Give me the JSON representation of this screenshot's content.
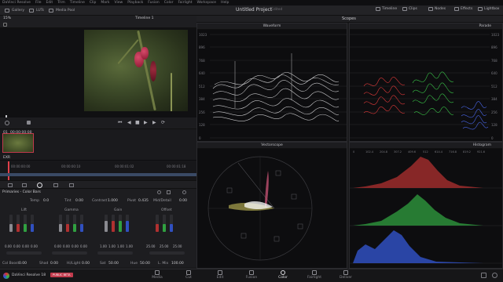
{
  "menubar": {
    "items": [
      "DaVinci Resolve",
      "File",
      "Edit",
      "Trim",
      "Timeline",
      "Clip",
      "Mark",
      "View",
      "Playback",
      "Fusion",
      "Color",
      "Fairlight",
      "Workspace",
      "Help"
    ]
  },
  "topbar": {
    "left_buttons": [
      "Gallery",
      "LUTs",
      "Media Pool"
    ],
    "project_title": "Untitled Project",
    "status": "Edited",
    "right_buttons": [
      "Timeline",
      "Clips",
      "Nodes",
      "Effects",
      "Lightbox"
    ]
  },
  "viewer": {
    "zoom": "15%",
    "timeline_name": "Timeline 1"
  },
  "clip": {
    "index": "01",
    "timecode": "00:00:00:00",
    "codec": "EXR"
  },
  "timeline": {
    "ruler": [
      "00:00:00:00",
      "00:00:00:10",
      "00:00:01:02",
      "00:00:01:18"
    ]
  },
  "scopes": {
    "header": "Scopes",
    "waveform": {
      "title": "Waveform",
      "scale": [
        "1023",
        "896",
        "768",
        "640",
        "512",
        "384",
        "256",
        "128",
        "0"
      ]
    },
    "parade": {
      "title": "Parade",
      "scale": [
        "1023",
        "896",
        "768",
        "640",
        "512",
        "384",
        "256",
        "128",
        "0"
      ]
    },
    "vectorscope": {
      "title": "Vectorscope"
    },
    "histogram": {
      "title": "Histogram",
      "scale": [
        "0",
        "102.4",
        "204.8",
        "307.2",
        "409.6",
        "512",
        "614.4",
        "716.8",
        "819.2",
        "921.6"
      ]
    }
  },
  "primaries": {
    "title": "Primaries - Color Bars",
    "controls": {
      "temp_label": "Temp",
      "temp": "0.0",
      "tint_label": "Tint",
      "tint": "0.00",
      "contrast_label": "Contrast",
      "contrast": "1.000",
      "pivot_label": "Pivot",
      "pivot": "0.435",
      "middetail_label": "Mid/Detail",
      "middetail": "0.00"
    },
    "wheels": [
      {
        "name": "Lift",
        "values": [
          "0.00",
          "0.00",
          "0.00",
          "0.00"
        ]
      },
      {
        "name": "Gamma",
        "values": [
          "0.00",
          "0.00",
          "0.00",
          "0.00"
        ]
      },
      {
        "name": "Gain",
        "values": [
          "1.00",
          "1.00",
          "1.00",
          "1.00"
        ]
      },
      {
        "name": "Offset",
        "values": [
          "25.00",
          "25.00",
          "25.00"
        ]
      }
    ],
    "footer": {
      "colboost_label": "Col Boost",
      "colboost": "0.00",
      "shad_label": "Shad",
      "shad": "0.00",
      "hilight_label": "Hi/Light",
      "hilight": "0.00",
      "sat_label": "Sat",
      "sat": "50.00",
      "hue_label": "Hue",
      "hue": "50.00",
      "lmix_label": "L. Mix",
      "lmix": "100.00"
    }
  },
  "footer": {
    "app": "DaVinci Resolve 18",
    "badge": "PUBLIC BETA"
  },
  "pages": [
    "Media",
    "Cut",
    "Edit",
    "Fusion",
    "Color",
    "Fairlight",
    "Deliver"
  ],
  "active_page": "Color",
  "colors": {
    "accent": "#c23b4d",
    "red": "#e03030",
    "green": "#30c040",
    "blue": "#3050e0"
  }
}
